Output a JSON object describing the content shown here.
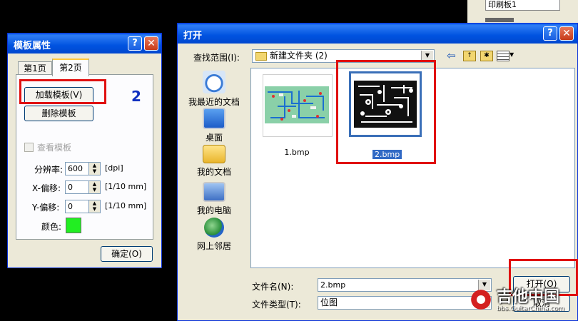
{
  "bg_window": {
    "title": "印刷板1"
  },
  "template_dialog": {
    "title": "模板属性",
    "tabs": [
      "第1页",
      "第2页"
    ],
    "load_button": "加载模板(V)",
    "delete_button": "删除模板",
    "annotation": "2",
    "view_checkbox": "查看模板",
    "resolution_label": "分辨率:",
    "resolution_value": "600",
    "resolution_unit": "[dpi]",
    "x_offset_label": "X-偏移:",
    "x_offset_value": "0",
    "x_offset_unit": "[1/10 mm]",
    "y_offset_label": "Y-偏移:",
    "y_offset_value": "0",
    "y_offset_unit": "[1/10 mm]",
    "color_label": "颜色:",
    "color_value": "#22ee22",
    "ok_button": "确定(O)"
  },
  "open_dialog": {
    "title": "打开",
    "lookin_label": "查找范围(I):",
    "lookin_value": "新建文件夹 (2)",
    "places": [
      "我最近的文档",
      "桌面",
      "我的文档",
      "我的电脑",
      "网上邻居"
    ],
    "files": [
      {
        "name": "1.bmp",
        "selected": false
      },
      {
        "name": "2.bmp",
        "selected": true
      }
    ],
    "filename_label": "文件名(N):",
    "filename_value": "2.bmp",
    "filetype_label": "文件类型(T):",
    "filetype_value": "位图",
    "open_button": "打开(O)",
    "cancel_button": "取消"
  },
  "watermark": {
    "text": "吉他中国",
    "url": "bbs.GuitarChina.com"
  }
}
